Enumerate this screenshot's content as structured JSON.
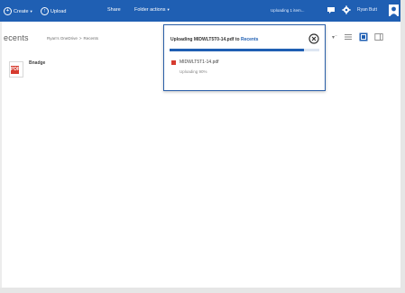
{
  "topbar": {
    "create_label": "Create",
    "upload_label": "Upload",
    "share_label": "Share",
    "folder_actions_label": "Folder actions",
    "status_text": "Uploading 1 item...",
    "user_name": "Ryan Butt",
    "bar_color": "#1f5fb3"
  },
  "header": {
    "page_title": "ecents",
    "breadcrumb": [
      "Ryan's OneDrive",
      ">",
      "Recents"
    ]
  },
  "files": [
    {
      "name": "Bnadge",
      "type_badge": "PDF"
    }
  ],
  "flyout": {
    "heading_prefix": "Uploading MIDWLT5T0-14.pdf to ",
    "heading_link": "Recents",
    "progress": 0.9,
    "item_name": "MIDWLT5T1-14.pdf",
    "item_status": "Uploading 90%"
  },
  "icons": {
    "create": "plus-circle-icon",
    "upload": "upload-icon",
    "flag": "flag-icon",
    "settings": "gear-icon",
    "avatar": "user-avatar-icon",
    "close": "close-circle-icon",
    "sort": "sort-icon",
    "list_view": "list-view-icon",
    "thumbnail_view": "thumbnail-view-icon",
    "details_pane": "details-pane-icon",
    "pdf": "pdf-file-icon"
  },
  "colors": {
    "accent": "#1f5fb3",
    "pdf_red": "#d63b2f"
  }
}
